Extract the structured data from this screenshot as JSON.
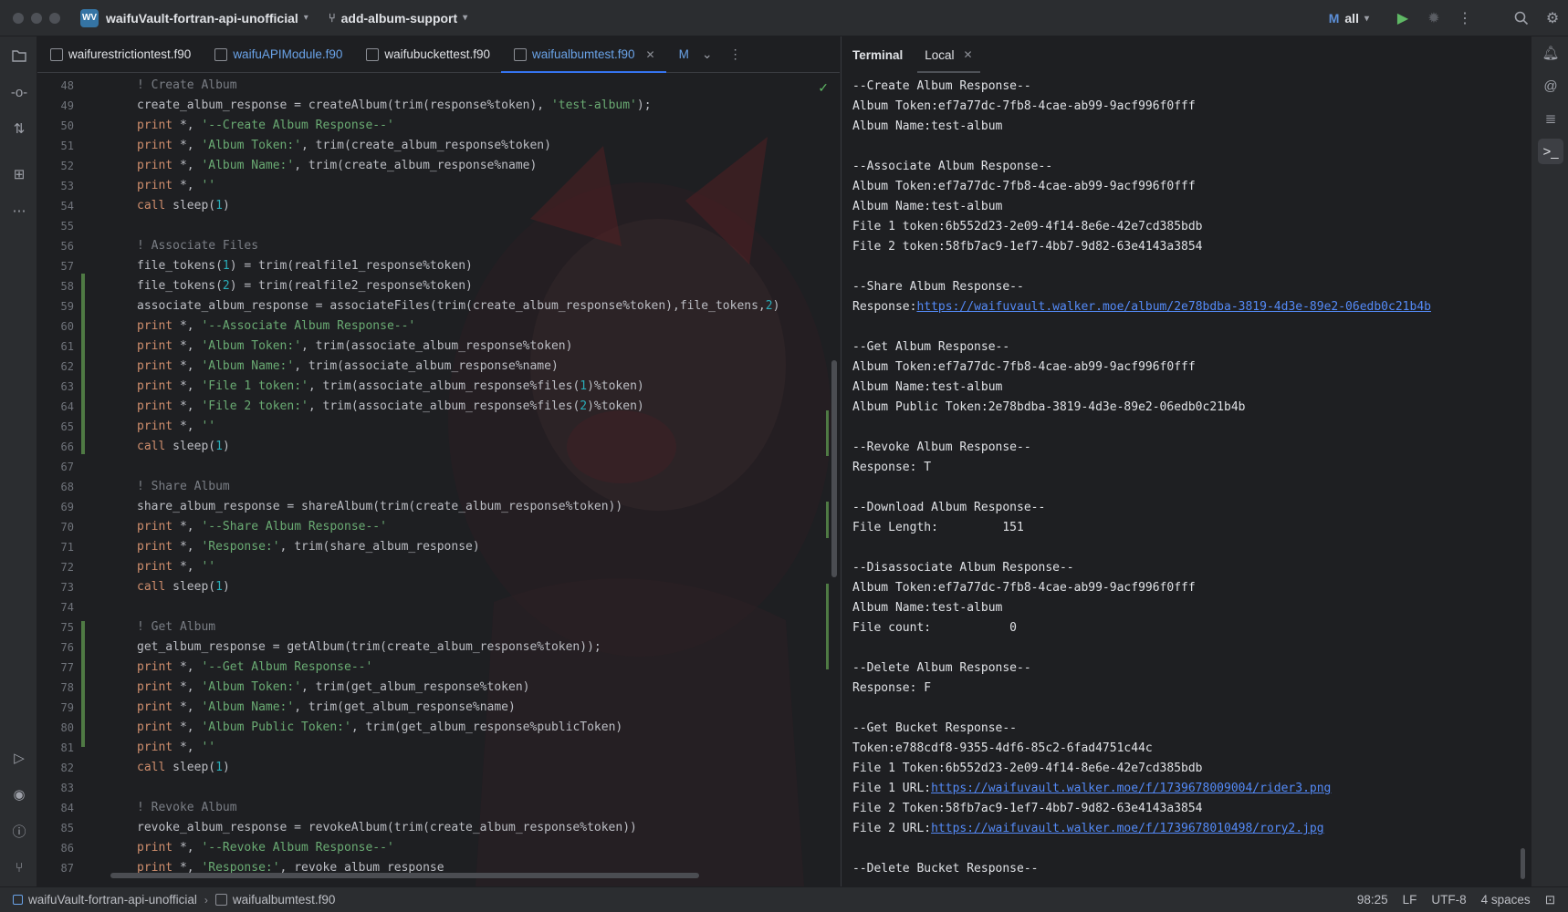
{
  "titlebar": {
    "project_badge": "WV",
    "project_name": "waifuVault-fortran-api-unofficial",
    "branch": "add-album-support",
    "run_config": "all"
  },
  "editor": {
    "tabs": [
      {
        "label": "waifurestrictiontest.f90",
        "ext": "f90"
      },
      {
        "label": "waifuAPIModule.f90",
        "ext": "f90"
      },
      {
        "label": "waifubuckettest.f90",
        "ext": "f90"
      },
      {
        "label": "waifualbumtest.f90",
        "ext": "f90"
      },
      {
        "label": "M",
        "ext": "M"
      }
    ],
    "lines": [
      {
        "n": "48",
        "text": "! Create Album",
        "cls": "comment"
      },
      {
        "n": "49",
        "text": "create_album_response = createAlbum(trim(response%token), 'test-album');",
        "cls": ""
      },
      {
        "n": "50",
        "text": "print *, '--Create Album Response--'",
        "cls": ""
      },
      {
        "n": "51",
        "text": "print *, 'Album Token:', trim(create_album_response%token)",
        "cls": ""
      },
      {
        "n": "52",
        "text": "print *, 'Album Name:', trim(create_album_response%name)",
        "cls": ""
      },
      {
        "n": "53",
        "text": "print *, ''",
        "cls": ""
      },
      {
        "n": "54",
        "text": "call sleep(1)",
        "cls": ""
      },
      {
        "n": "55",
        "text": "",
        "cls": ""
      },
      {
        "n": "56",
        "text": "! Associate Files",
        "cls": "comment"
      },
      {
        "n": "57",
        "text": "file_tokens(1) = trim(realfile1_response%token)",
        "cls": ""
      },
      {
        "n": "58",
        "text": "file_tokens(2) = trim(realfile2_response%token)",
        "cls": ""
      },
      {
        "n": "59",
        "text": "associate_album_response = associateFiles(trim(create_album_response%token),file_tokens,2)",
        "cls": ""
      },
      {
        "n": "60",
        "text": "print *, '--Associate Album Response--'",
        "cls": ""
      },
      {
        "n": "61",
        "text": "print *, 'Album Token:', trim(associate_album_response%token)",
        "cls": ""
      },
      {
        "n": "62",
        "text": "print *, 'Album Name:', trim(associate_album_response%name)",
        "cls": ""
      },
      {
        "n": "63",
        "text": "print *, 'File 1 token:', trim(associate_album_response%files(1)%token)",
        "cls": ""
      },
      {
        "n": "64",
        "text": "print *, 'File 2 token:', trim(associate_album_response%files(2)%token)",
        "cls": ""
      },
      {
        "n": "65",
        "text": "print *, ''",
        "cls": ""
      },
      {
        "n": "66",
        "text": "call sleep(1)",
        "cls": ""
      },
      {
        "n": "67",
        "text": "",
        "cls": ""
      },
      {
        "n": "68",
        "text": "! Share Album",
        "cls": "comment"
      },
      {
        "n": "69",
        "text": "share_album_response = shareAlbum(trim(create_album_response%token))",
        "cls": ""
      },
      {
        "n": "70",
        "text": "print *, '--Share Album Response--'",
        "cls": ""
      },
      {
        "n": "71",
        "text": "print *, 'Response:', trim(share_album_response)",
        "cls": ""
      },
      {
        "n": "72",
        "text": "print *, ''",
        "cls": ""
      },
      {
        "n": "73",
        "text": "call sleep(1)",
        "cls": ""
      },
      {
        "n": "74",
        "text": "",
        "cls": ""
      },
      {
        "n": "75",
        "text": "! Get Album",
        "cls": "comment"
      },
      {
        "n": "76",
        "text": "get_album_response = getAlbum(trim(create_album_response%token));",
        "cls": ""
      },
      {
        "n": "77",
        "text": "print *, '--Get Album Response--'",
        "cls": ""
      },
      {
        "n": "78",
        "text": "print *, 'Album Token:', trim(get_album_response%token)",
        "cls": ""
      },
      {
        "n": "79",
        "text": "print *, 'Album Name:', trim(get_album_response%name)",
        "cls": ""
      },
      {
        "n": "80",
        "text": "print *, 'Album Public Token:', trim(get_album_response%publicToken)",
        "cls": ""
      },
      {
        "n": "81",
        "text": "print *, ''",
        "cls": ""
      },
      {
        "n": "82",
        "text": "call sleep(1)",
        "cls": ""
      },
      {
        "n": "83",
        "text": "",
        "cls": ""
      },
      {
        "n": "84",
        "text": "! Revoke Album",
        "cls": "comment"
      },
      {
        "n": "85",
        "text": "revoke_album_response = revokeAlbum(trim(create_album_response%token))",
        "cls": ""
      },
      {
        "n": "86",
        "text": "print *, '--Revoke Album Response--'",
        "cls": ""
      },
      {
        "n": "87",
        "text": "print *, 'Response:', revoke_album_response",
        "cls": ""
      }
    ]
  },
  "terminal": {
    "title": "Terminal",
    "tab": "Local",
    "lines": [
      {
        "text": "--Create Album Response--"
      },
      {
        "text": "Album Token:ef7a77dc-7fb8-4cae-ab99-9acf996f0fff"
      },
      {
        "text": "Album Name:test-album"
      },
      {
        "text": ""
      },
      {
        "text": "--Associate Album Response--"
      },
      {
        "text": "Album Token:ef7a77dc-7fb8-4cae-ab99-9acf996f0fff"
      },
      {
        "text": "Album Name:test-album"
      },
      {
        "text": "File 1 token:6b552d23-2e09-4f14-8e6e-42e7cd385bdb"
      },
      {
        "text": "File 2 token:58fb7ac9-1ef7-4bb7-9d82-63e4143a3854"
      },
      {
        "text": ""
      },
      {
        "text": "--Share Album Response--"
      },
      {
        "text": "Response:",
        "link": "https://waifuvault.walker.moe/album/2e78bdba-3819-4d3e-89e2-06edb0c21b4b"
      },
      {
        "text": ""
      },
      {
        "text": "--Get Album Response--"
      },
      {
        "text": "Album Token:ef7a77dc-7fb8-4cae-ab99-9acf996f0fff"
      },
      {
        "text": "Album Name:test-album"
      },
      {
        "text": "Album Public Token:2e78bdba-3819-4d3e-89e2-06edb0c21b4b"
      },
      {
        "text": ""
      },
      {
        "text": "--Revoke Album Response--"
      },
      {
        "text": "Response: T"
      },
      {
        "text": ""
      },
      {
        "text": "--Download Album Response--"
      },
      {
        "text": "File Length:         151"
      },
      {
        "text": ""
      },
      {
        "text": "--Disassociate Album Response--"
      },
      {
        "text": "Album Token:ef7a77dc-7fb8-4cae-ab99-9acf996f0fff"
      },
      {
        "text": "Album Name:test-album"
      },
      {
        "text": "File count:           0"
      },
      {
        "text": ""
      },
      {
        "text": "--Delete Album Response--"
      },
      {
        "text": "Response: F"
      },
      {
        "text": ""
      },
      {
        "text": "--Get Bucket Response--"
      },
      {
        "text": "Token:e788cdf8-9355-4df6-85c2-6fad4751c44c"
      },
      {
        "text": "File 1 Token:6b552d23-2e09-4f14-8e6e-42e7cd385bdb"
      },
      {
        "text": "File 1 URL:",
        "link": "https://waifuvault.walker.moe/f/1739678009004/rider3.png"
      },
      {
        "text": "File 2 Token:58fb7ac9-1ef7-4bb7-9d82-63e4143a3854"
      },
      {
        "text": "File 2 URL:",
        "link": "https://waifuvault.walker.moe/f/1739678010498/rory2.jpg"
      },
      {
        "text": ""
      },
      {
        "text": "--Delete Bucket Response--"
      }
    ]
  },
  "statusbar": {
    "project": "waifuVault-fortran-api-unofficial",
    "file": "waifualbumtest.f90",
    "position": "98:25",
    "line_ending": "LF",
    "encoding": "UTF-8",
    "indent": "4 spaces"
  },
  "colors": {
    "background": "#1e1f22",
    "panel": "#2b2d30",
    "accent": "#3574f0",
    "link": "#548af7",
    "string": "#6aab73",
    "number": "#2aacb8",
    "comment": "#7a7e85",
    "keyword": "#cf8e6d"
  }
}
